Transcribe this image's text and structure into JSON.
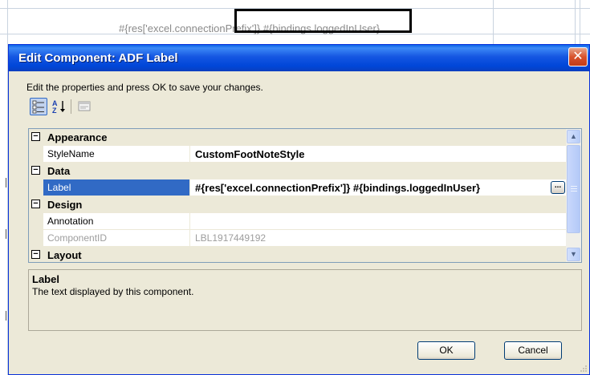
{
  "background": {
    "cell_text_left": "#{res['excel.connection",
    "cell_text_right": "Prefix']} #{bindings.loggedInUser}"
  },
  "dialog": {
    "title": "Edit Component: ADF Label",
    "close_label": "✕",
    "instructions": "Edit the properties and press OK to save your changes.",
    "toolbar": {
      "categorized_icon": "categorized-icon",
      "alphabetical_icon": "alphabetical-sort-icon",
      "property_pages_icon": "property-pages-icon"
    },
    "grid": {
      "categories": [
        {
          "label": "Appearance",
          "toggle": "⊟"
        },
        {
          "label": "Data",
          "toggle": "⊟"
        },
        {
          "label": "Design",
          "toggle": "⊟"
        },
        {
          "label": "Layout",
          "toggle": "⊟"
        }
      ],
      "properties": {
        "stylename": {
          "name": "StyleName",
          "value": "CustomFootNoteStyle"
        },
        "label": {
          "name": "Label",
          "value": "#{res['excel.connectionPrefix']} #{bindings.loggedInUser}"
        },
        "annotation": {
          "name": "Annotation",
          "value": ""
        },
        "componentid": {
          "name": "ComponentID",
          "value": "LBL1917449192"
        }
      },
      "ellipsis_label": "..."
    },
    "description": {
      "title": "Label",
      "text": "The text displayed by this component."
    },
    "buttons": {
      "ok": "OK",
      "cancel": "Cancel"
    },
    "colors": {
      "titlebar": "#0046d8",
      "selection": "#316ac5",
      "dialog_bg": "#ece9d8"
    }
  }
}
